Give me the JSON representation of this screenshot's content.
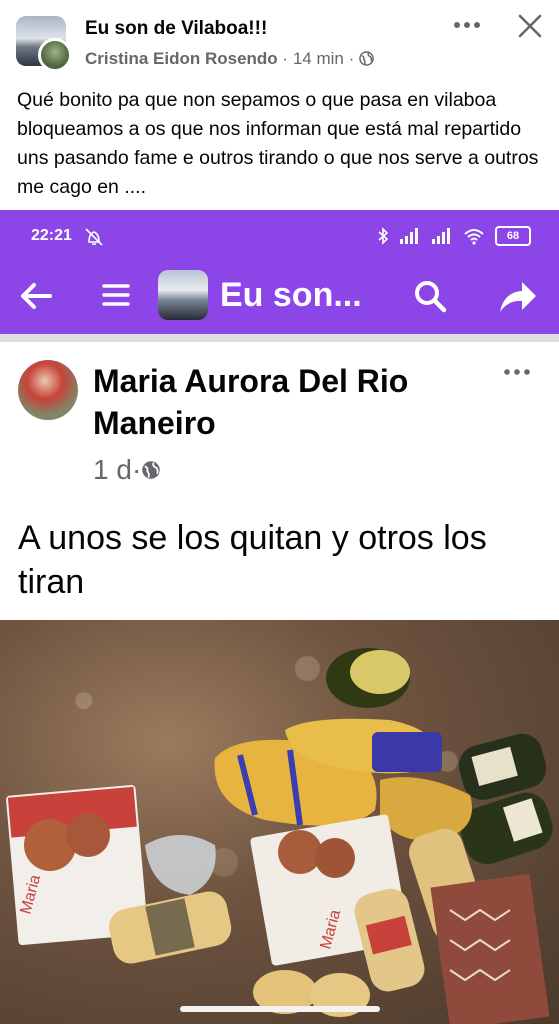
{
  "post": {
    "group_name": "Eu son de Vilaboa!!!",
    "author": "Cristina Eidon Rosendo",
    "time": "14 min",
    "separator": "·",
    "text": "Qué bonito pa que non sepamos o que pasa en vilaboa bloqueamos  a os que nos informan que está mal repartido uns pasando fame e outros tirando o que nos serve a outros me cago en ...."
  },
  "embedded": {
    "status_time": "22:21",
    "battery": "68",
    "app_title": "Eu son...",
    "inner_author": "Maria Aurora Del Rio Maneiro",
    "inner_time": "1 d",
    "inner_separator": "·",
    "inner_text": "A unos se los quitan y otros los tiran",
    "photo_package_text_1": "Maria",
    "photo_package_text_2": "Maria"
  },
  "colors": {
    "accent_purple": "#8c45e6",
    "meta_gray": "#65676b"
  },
  "icons": [
    "more-icon",
    "close-icon",
    "globe-icon",
    "back-arrow-icon",
    "menu-icon",
    "search-icon",
    "share-icon",
    "bluetooth-icon",
    "signal-icon",
    "wifi-icon",
    "battery-icon",
    "alarm-off-icon"
  ]
}
